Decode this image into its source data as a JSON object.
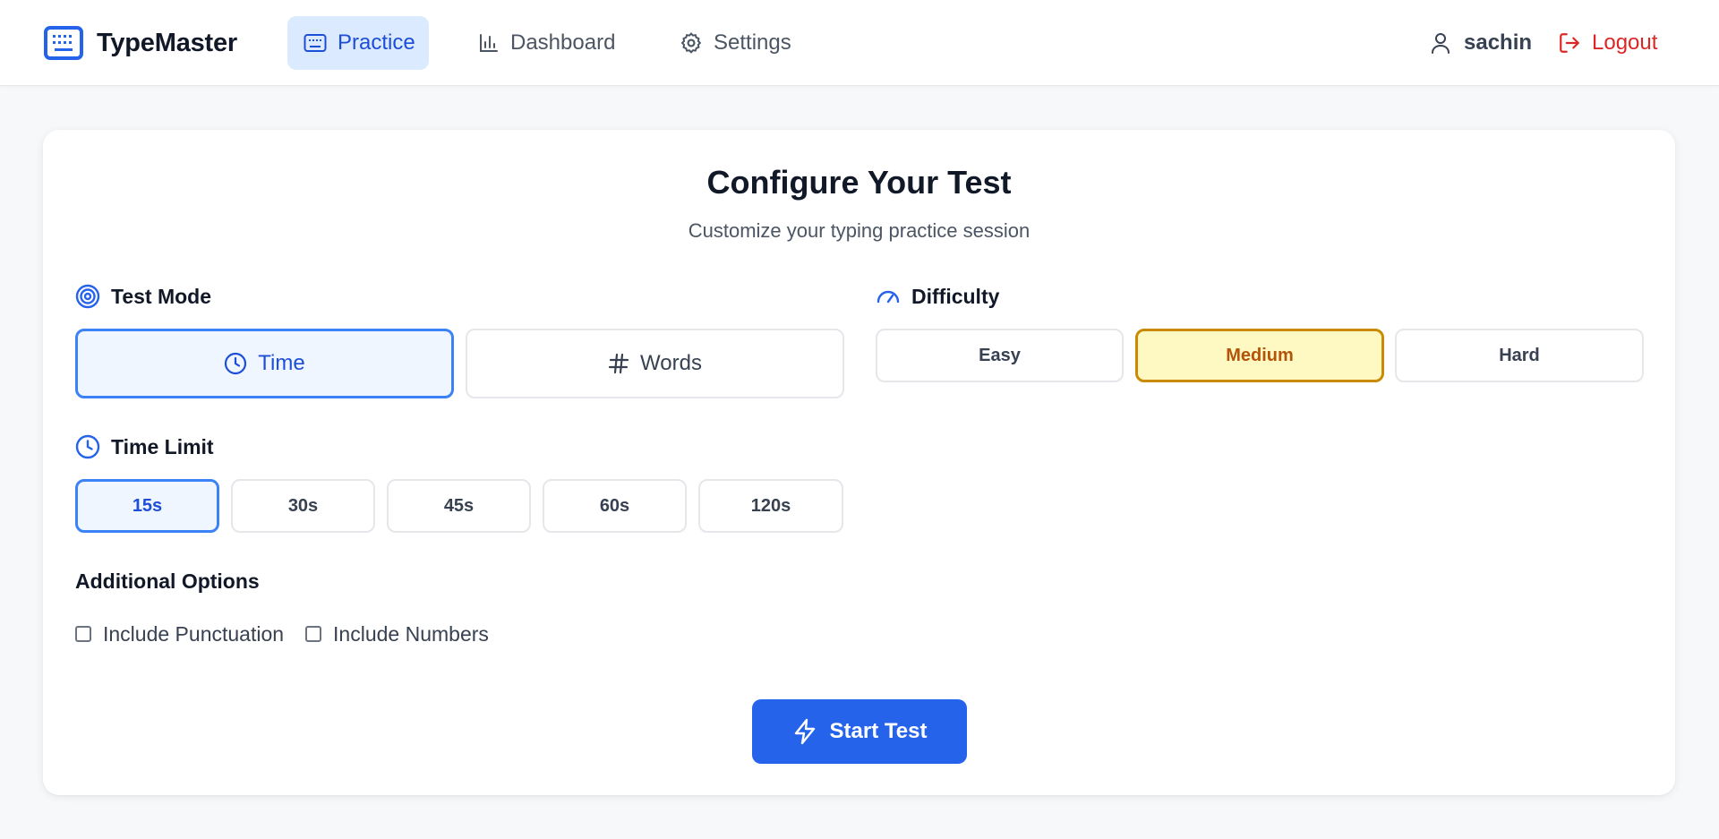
{
  "colors": {
    "primary": "#2563eb",
    "primary_light": "#dbeafe",
    "difficulty_selected_bg": "#fef9c3",
    "difficulty_selected_border": "#ca8a04",
    "logout": "#dc2626"
  },
  "navbar": {
    "brand": {
      "name": "TypeMaster",
      "icon": "keyboard-icon"
    },
    "items": [
      {
        "label": "Practice",
        "icon": "keyboard-icon",
        "active": true
      },
      {
        "label": "Dashboard",
        "icon": "bar-chart-icon",
        "active": false
      },
      {
        "label": "Settings",
        "icon": "gear-icon",
        "active": false
      }
    ],
    "user": {
      "name": "sachin",
      "icon": "user-icon"
    },
    "logout": {
      "label": "Logout",
      "icon": "logout-icon"
    }
  },
  "config": {
    "title": "Configure Your Test",
    "subtitle": "Customize your typing practice session",
    "test_mode": {
      "label": "Test Mode",
      "icon": "target-icon",
      "options": [
        {
          "label": "Time",
          "icon": "clock-icon",
          "selected": true
        },
        {
          "label": "Words",
          "icon": "hash-icon",
          "selected": false
        }
      ]
    },
    "difficulty": {
      "label": "Difficulty",
      "icon": "gauge-icon",
      "options": [
        {
          "label": "Easy",
          "selected": false
        },
        {
          "label": "Medium",
          "selected": true
        },
        {
          "label": "Hard",
          "selected": false
        }
      ]
    },
    "time_limit": {
      "label": "Time Limit",
      "icon": "clock-icon",
      "options": [
        {
          "label": "15s",
          "selected": true
        },
        {
          "label": "30s",
          "selected": false
        },
        {
          "label": "45s",
          "selected": false
        },
        {
          "label": "60s",
          "selected": false
        },
        {
          "label": "120s",
          "selected": false
        }
      ]
    },
    "additional_options": {
      "label": "Additional Options",
      "checkboxes": [
        {
          "label": "Include Punctuation",
          "checked": false
        },
        {
          "label": "Include Numbers",
          "checked": false
        }
      ]
    },
    "start_button": {
      "label": "Start Test",
      "icon": "lightning-icon"
    }
  }
}
